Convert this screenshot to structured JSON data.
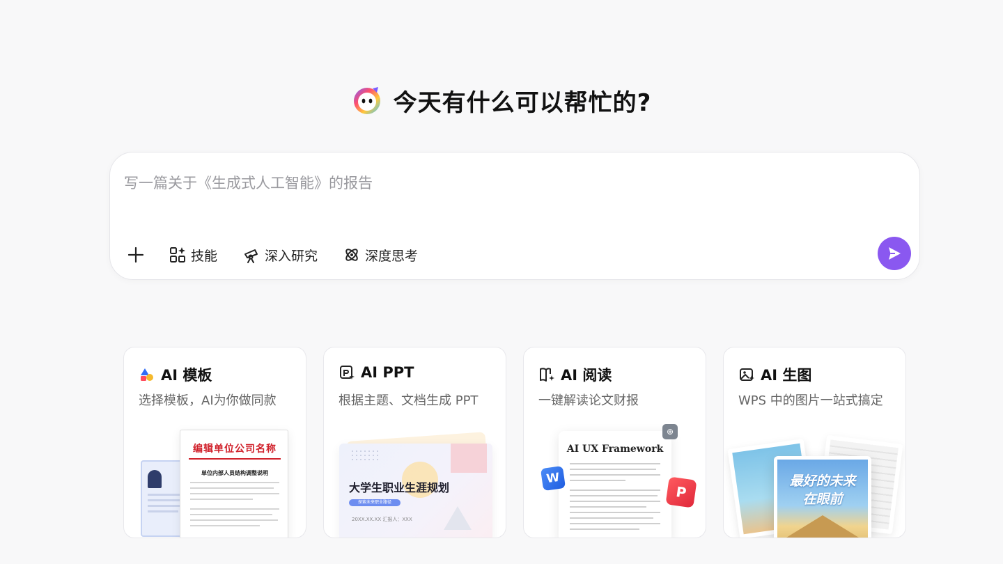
{
  "hero": {
    "title": "今天有什么可以帮忙的?"
  },
  "composer": {
    "placeholder": "写一篇关于《生成式人工智能》的报告",
    "tools": {
      "skills_label": "技能",
      "research_label": "深入研究",
      "thinking_label": "深度思考"
    }
  },
  "cards": [
    {
      "title": "AI 模板",
      "desc": "选择模板，AI为你做同款",
      "preview": {
        "heading": "编辑单位公司名称",
        "subheading": "单位内部人员结构调整说明"
      }
    },
    {
      "title": "AI PPT",
      "desc": "根据主题、文档生成 PPT",
      "preview": {
        "slide_title": "大学生职业生涯规划",
        "pill": "探索未来职业路径",
        "meta": "20XX.XX.XX      汇报人：XXX"
      }
    },
    {
      "title": "AI 阅读",
      "desc": "一键解读论文财报",
      "preview": {
        "paper_title": "AI UX Framework",
        "w_badge": "W",
        "p_badge": "P",
        "g_badge": "⊕"
      }
    },
    {
      "title": "AI 生图",
      "desc": "WPS 中的图片一站式搞定",
      "preview": {
        "art_text_1": "最好的未来",
        "art_text_2": "在眼前"
      }
    }
  ],
  "colors": {
    "accent": "#8a58f0",
    "background": "#f8f8f9",
    "doc_red": "#d0202a"
  }
}
